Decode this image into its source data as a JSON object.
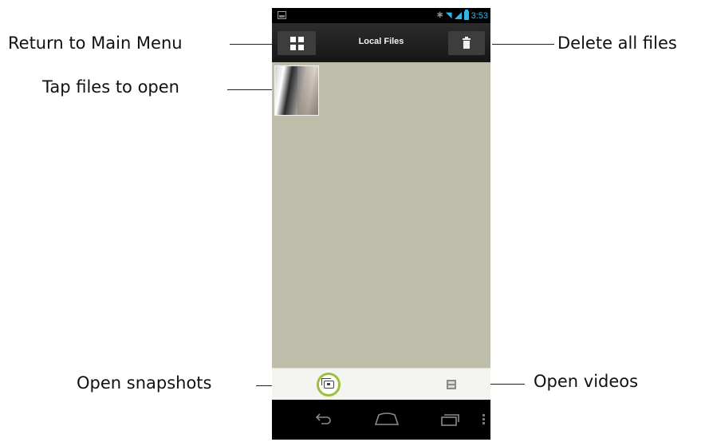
{
  "callouts": {
    "return_main_menu": "Return to Main Menu",
    "delete_all": "Delete all files",
    "tap_files": "Tap files to open",
    "open_snapshots": "Open snapshots",
    "open_videos": "Open videos"
  },
  "status_bar": {
    "time": "3:53",
    "icons": [
      "notification-icon",
      "bluetooth-icon",
      "wifi-icon",
      "signal-icon",
      "battery-icon"
    ]
  },
  "action_bar": {
    "title": "Local Files",
    "left_icon": "grid-icon",
    "right_icon": "trash-icon"
  },
  "files": [
    {
      "type": "snapshot",
      "icon": "thumbnail"
    }
  ],
  "bottom_bar": {
    "snapshots_icon": "snapshots-icon",
    "videos_icon": "video-icon",
    "active": "snapshots"
  },
  "nav_bar": {
    "icons": [
      "back-icon",
      "home-icon",
      "recent-apps-icon",
      "overflow-menu-icon"
    ]
  },
  "colors": {
    "content_background": "#bdbdaa",
    "status_accent": "#33b5e5",
    "snapshot_ring": "#9bc03a",
    "action_bar": "#1f1f1f"
  }
}
